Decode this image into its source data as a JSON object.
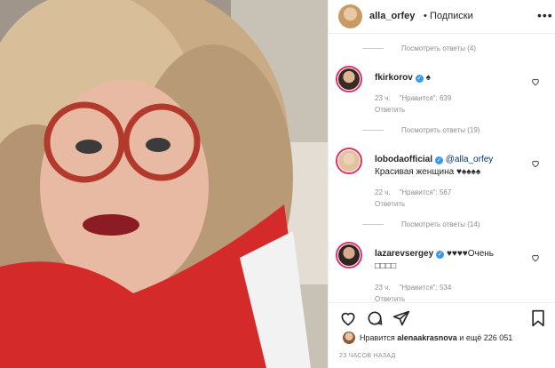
{
  "header": {
    "username": "alla_orfey",
    "separator": "•",
    "follow_status": "Подписки",
    "more": "•••"
  },
  "comments": {
    "view_replies": [
      "Посмотреть ответы (4)",
      "Посмотреть ответы (19)",
      "Посмотреть ответы (14)"
    ],
    "items": [
      {
        "username": "fkirkorov",
        "verified": "✓",
        "text": "♠",
        "time": "23 ч.",
        "likes": "\"Нравится\": 639",
        "reply": "Ответить"
      },
      {
        "username": "lobodaofficial",
        "verified": "✓",
        "mention": "@alla_orfey",
        "text": "Красивая женщина ♥♠♠♠♠",
        "time": "22 ч.",
        "likes": "\"Нравится\": 567",
        "reply": "Ответить"
      },
      {
        "username": "lazarevsergey",
        "verified": "✓",
        "text": "♥♥♥♥Очень",
        "text2": "□□□□",
        "time": "23 ч.",
        "likes": "\"Нравится\": 534",
        "reply": "Ответить"
      }
    ]
  },
  "actions": {
    "likes_prefix": "Нравится",
    "likes_user": "alenaakrasnova",
    "likes_suffix": "и ещё 226 051",
    "timestamp": "23 ЧАСОВ НАЗАД"
  },
  "colors": {
    "link": "#00376b",
    "muted": "#8e8e8e",
    "verified": "#3897f0",
    "story_ring": "#e1306c"
  }
}
